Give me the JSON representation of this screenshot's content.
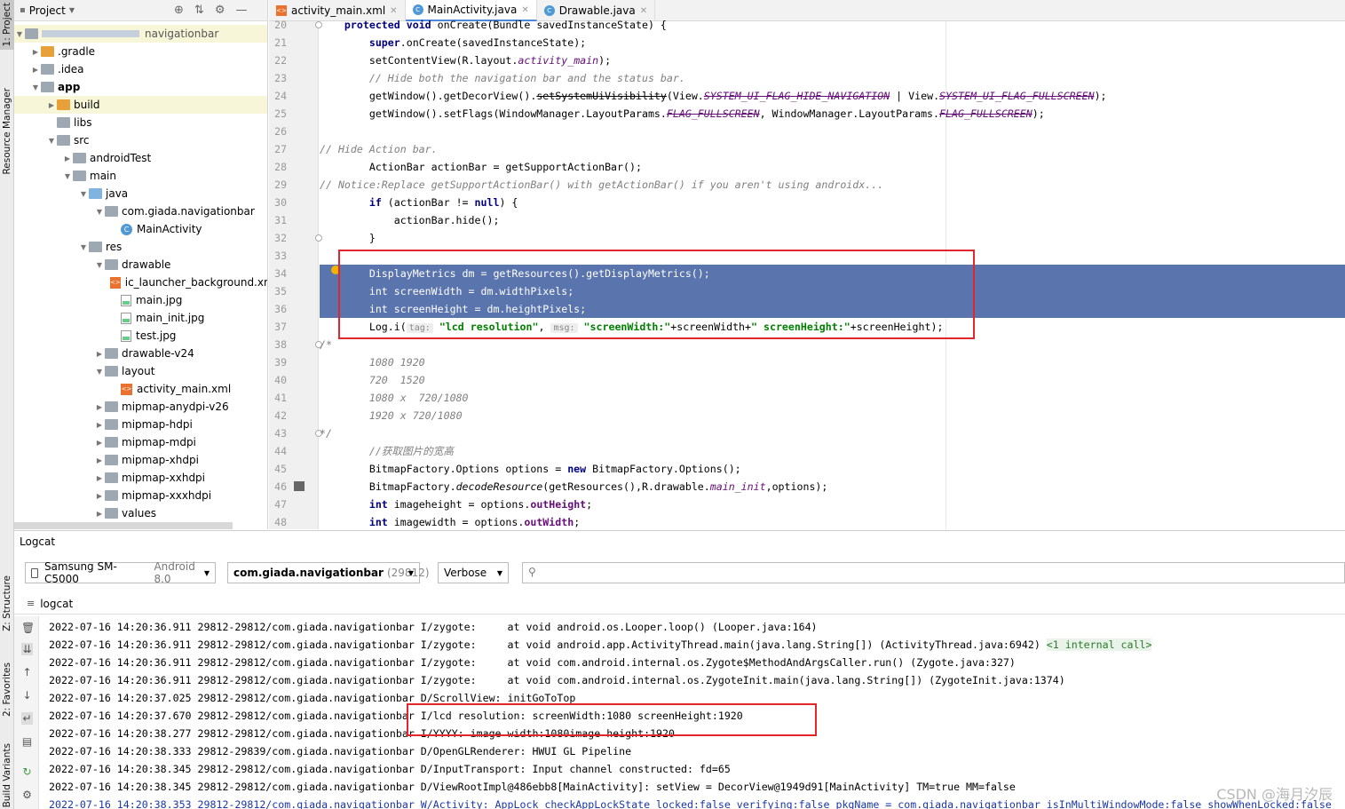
{
  "strip": {
    "project": "1: Project",
    "resource_manager": "Resource Manager",
    "structure": "Z: Structure",
    "favorites": "2: Favorites",
    "build_variants": "Build Variants"
  },
  "project": {
    "title": "Project",
    "root_label": "navigationbar",
    "tree": [
      {
        "label": ".gradle",
        "indent": 1,
        "arrow": "▶",
        "icon": "orange"
      },
      {
        "label": ".idea",
        "indent": 1,
        "arrow": "▶",
        "icon": "gray"
      },
      {
        "label": "app",
        "indent": 1,
        "arrow": "▼",
        "icon": "gray",
        "bold": true
      },
      {
        "label": "build",
        "indent": 2,
        "arrow": "▶",
        "icon": "orange",
        "hl": true
      },
      {
        "label": "libs",
        "indent": 2,
        "arrow": "",
        "icon": "gray"
      },
      {
        "label": "src",
        "indent": 2,
        "arrow": "▼",
        "icon": "gray"
      },
      {
        "label": "androidTest",
        "indent": 3,
        "arrow": "▶",
        "icon": "gray"
      },
      {
        "label": "main",
        "indent": 3,
        "arrow": "▼",
        "icon": "gray"
      },
      {
        "label": "java",
        "indent": 4,
        "arrow": "▼",
        "icon": "blue"
      },
      {
        "label": "com.giada.navigationbar",
        "indent": 5,
        "arrow": "▼",
        "icon": "gray"
      },
      {
        "label": "MainActivity",
        "indent": 6,
        "arrow": "",
        "icon": "class"
      },
      {
        "label": "res",
        "indent": 4,
        "arrow": "▼",
        "icon": "gray"
      },
      {
        "label": "drawable",
        "indent": 5,
        "arrow": "▼",
        "icon": "gray"
      },
      {
        "label": "ic_launcher_background.xml",
        "indent": 6,
        "arrow": "",
        "icon": "xml"
      },
      {
        "label": "main.jpg",
        "indent": 6,
        "arrow": "",
        "icon": "img"
      },
      {
        "label": "main_init.jpg",
        "indent": 6,
        "arrow": "",
        "icon": "img"
      },
      {
        "label": "test.jpg",
        "indent": 6,
        "arrow": "",
        "icon": "img"
      },
      {
        "label": "drawable-v24",
        "indent": 5,
        "arrow": "▶",
        "icon": "gray"
      },
      {
        "label": "layout",
        "indent": 5,
        "arrow": "▼",
        "icon": "gray"
      },
      {
        "label": "activity_main.xml",
        "indent": 6,
        "arrow": "",
        "icon": "xml"
      },
      {
        "label": "mipmap-anydpi-v26",
        "indent": 5,
        "arrow": "▶",
        "icon": "gray"
      },
      {
        "label": "mipmap-hdpi",
        "indent": 5,
        "arrow": "▶",
        "icon": "gray"
      },
      {
        "label": "mipmap-mdpi",
        "indent": 5,
        "arrow": "▶",
        "icon": "gray"
      },
      {
        "label": "mipmap-xhdpi",
        "indent": 5,
        "arrow": "▶",
        "icon": "gray"
      },
      {
        "label": "mipmap-xxhdpi",
        "indent": 5,
        "arrow": "▶",
        "icon": "gray"
      },
      {
        "label": "mipmap-xxxhdpi",
        "indent": 5,
        "arrow": "▶",
        "icon": "gray"
      },
      {
        "label": "values",
        "indent": 5,
        "arrow": "▶",
        "icon": "gray"
      }
    ]
  },
  "tabs": [
    {
      "label": "activity_main.xml",
      "kind": "xml",
      "active": false
    },
    {
      "label": "MainActivity.java",
      "kind": "class",
      "active": true
    },
    {
      "label": "Drawable.java",
      "kind": "class",
      "active": false
    }
  ],
  "code": {
    "line_numbers": [
      "20",
      "21",
      "22",
      "23",
      "24",
      "25",
      "26",
      "27",
      "28",
      "29",
      "30",
      "31",
      "32",
      "33",
      "34",
      "35",
      "36",
      "37",
      "38",
      "39",
      "40",
      "41",
      "42",
      "43",
      "44",
      "45",
      "46",
      "47",
      "48"
    ],
    "lines": [
      "    <k>protected</k> <k>void</k> onCreate(Bundle savedInstanceState) {",
      "        <k>super</k>.onCreate(savedInstanceState);",
      "        setContentView(R.layout.<f>activity_main</f>);",
      "        <c>// Hide both the navigation bar and the status bar.</c>",
      "        getWindow().getDecorView().<s>setSystemUiVisibility</s>(View.<fs>SYSTEM_UI_FLAG_HIDE_NAVIGATION</fs> | View.<fs>SYSTEM_UI_FLAG_FULLSCREEN</fs>);",
      "        getWindow().setFlags(WindowManager.LayoutParams.<fs>FLAG_FULLSCREEN</fs>, WindowManager.LayoutParams.<fs>FLAG_FULLSCREEN</fs>);",
      "",
      "<c>// Hide Action bar.</c>",
      "        ActionBar actionBar = getSupportActionBar();",
      "<c>// Notice:Replace getSupportActionBar() with getActionBar() if you aren't using androidx...</c>",
      "        <k>if</k> (actionBar != <k>null</k>) {",
      "            actionBar.hide();",
      "        }",
      "",
      "        DisplayMetrics dm = getResources().getDisplayMetrics();",
      "        int screenWidth = dm.widthPixels;",
      "        int screenHeight = dm.heightPixels;",
      "        Log.i(<h>tag:</h> <t>\"lcd resolution\"</t>, <h>msg:</h> <t>\"screenWidth:\"</t>+screenWidth+<t>\" screenHeight:\"</t>+screenHeight);",
      "<c>/*</c>",
      "        <c>1080 1920</c>",
      "        <c>720  1520</c>",
      "        <c>1080 x  720/1080</c>",
      "        <c>1920 x 720/1080</c>",
      "<c>*/</c>",
      "        <c>//获取图片的宽高</c>",
      "        BitmapFactory.Options options = <k>new</k> BitmapFactory.Options();",
      "        BitmapFactory.<i>decodeResource</i>(getResources(),R.drawable.<f>main_init</f>,options);",
      "        <k>int</k> imageheight = options.<b>outHeight</b>;",
      "        <k>int</k> imagewidth = options.<b>outWidth</b>;"
    ],
    "selected_lines": [
      14,
      15,
      16
    ]
  },
  "logcat": {
    "title": "Logcat",
    "device": "Samsung SM-C5000",
    "device_os": "Android 8.0",
    "process": "com.giada.navigationbar",
    "pid": "(29812)",
    "level": "Verbose",
    "search_placeholder": "",
    "tab_label": "logcat",
    "lines": [
      {
        "text": "2022-07-16 14:20:36.911 29812-29812/com.giada.navigationbar I/zygote:     at void android.os.Looper.loop() (Looper.java:164)",
        "extra": ""
      },
      {
        "text": "2022-07-16 14:20:36.911 29812-29812/com.giada.navigationbar I/zygote:     at void android.app.ActivityThread.main(java.lang.String[]) (ActivityThread.java:6942) ",
        "extra": "<1 internal call>"
      },
      {
        "text": "2022-07-16 14:20:36.911 29812-29812/com.giada.navigationbar I/zygote:     at void com.android.internal.os.Zygote$MethodAndArgsCaller.run() (Zygote.java:327)",
        "extra": ""
      },
      {
        "text": "2022-07-16 14:20:36.911 29812-29812/com.giada.navigationbar I/zygote:     at void com.android.internal.os.ZygoteInit.main(java.lang.String[]) (ZygoteInit.java:1374)",
        "extra": ""
      },
      {
        "text": "2022-07-16 14:20:37.025 29812-29812/com.giada.navigationbar D/ScrollView: initGoToTop",
        "extra": ""
      },
      {
        "text": "2022-07-16 14:20:37.670 29812-29812/com.giada.navigationbar I/lcd resolution: screenWidth:1080 screenHeight:1920",
        "extra": ""
      },
      {
        "text": "2022-07-16 14:20:38.277 29812-29812/com.giada.navigationbar I/YYYY: image width:1080image height:1920",
        "extra": ""
      },
      {
        "text": "2022-07-16 14:20:38.333 29812-29839/com.giada.navigationbar D/OpenGLRenderer: HWUI GL Pipeline",
        "extra": ""
      },
      {
        "text": "2022-07-16 14:20:38.345 29812-29812/com.giada.navigationbar D/InputTransport: Input channel constructed: fd=65",
        "extra": ""
      },
      {
        "text": "2022-07-16 14:20:38.345 29812-29812/com.giada.navigationbar D/ViewRootImpl@486ebb8[MainActivity]: setView = DecorView@1949d91[MainActivity] TM=true MM=false",
        "extra": ""
      },
      {
        "text": "2022-07-16 14:20:38.353 29812-29812/com.giada.navigationbar W/Activity: AppLock checkAppLockState locked:false verifying:false pkgName = com.giada.navigationbar isInMultiWindowMode:false showWhenLocked:false",
        "extra": "",
        "warn": true
      }
    ]
  },
  "watermark": "CSDN @海月汐辰",
  "colors": {
    "selection": "#5a74ad",
    "annotation_box": "#e3262b",
    "accent_tab": "#4a8ad8"
  }
}
